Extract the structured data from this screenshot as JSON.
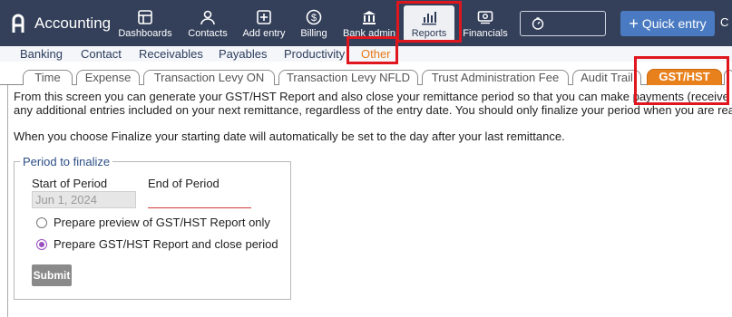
{
  "brand": {
    "name": "Accounting"
  },
  "nav": {
    "dashboards": "Dashboards",
    "contacts": "Contacts",
    "add_entry": "Add entry",
    "billing": "Billing",
    "bank_admin": "Bank admin",
    "reports": "Reports",
    "financials": "Financials"
  },
  "quick_entry": "Quick entry",
  "cut_letter": "C",
  "subnav": {
    "banking": "Banking",
    "contact": "Contact",
    "receivables": "Receivables",
    "payables": "Payables",
    "productivity": "Productivity",
    "other": "Other"
  },
  "tabs": {
    "time": "Time",
    "expense": "Expense",
    "levy_on": "Transaction Levy ON",
    "levy_nfld": "Transaction Levy NFLD",
    "trust_fee": "Trust Administration Fee",
    "audit_trail": "Audit Trail",
    "gst_hst": "GST/HST"
  },
  "content": {
    "desc_line1": "From this screen you can generate your GST/HST Report and also close your remittance period so that you can make payments (receive refu",
    "desc_line2": "any additional entries included on your next remittance, regardless of the entry date. You should only finalize your period when you are ready t",
    "desc_line3": "When you choose Finalize your starting date will automatically be set to the day after your last remittance.",
    "legend": "Period to finalize",
    "start_label": "Start of Period",
    "start_value": "Jun 1, 2024",
    "end_label": "End of Period",
    "option_preview": "Prepare preview of GST/HST Report only",
    "option_close": "Prepare GST/HST Report and close period",
    "submit": "Submit"
  },
  "colors": {
    "topbar": "#34405a",
    "accent_orange": "#e8801c",
    "highlight_red": "#e0161e",
    "radio_purple": "#9a4fbf"
  }
}
